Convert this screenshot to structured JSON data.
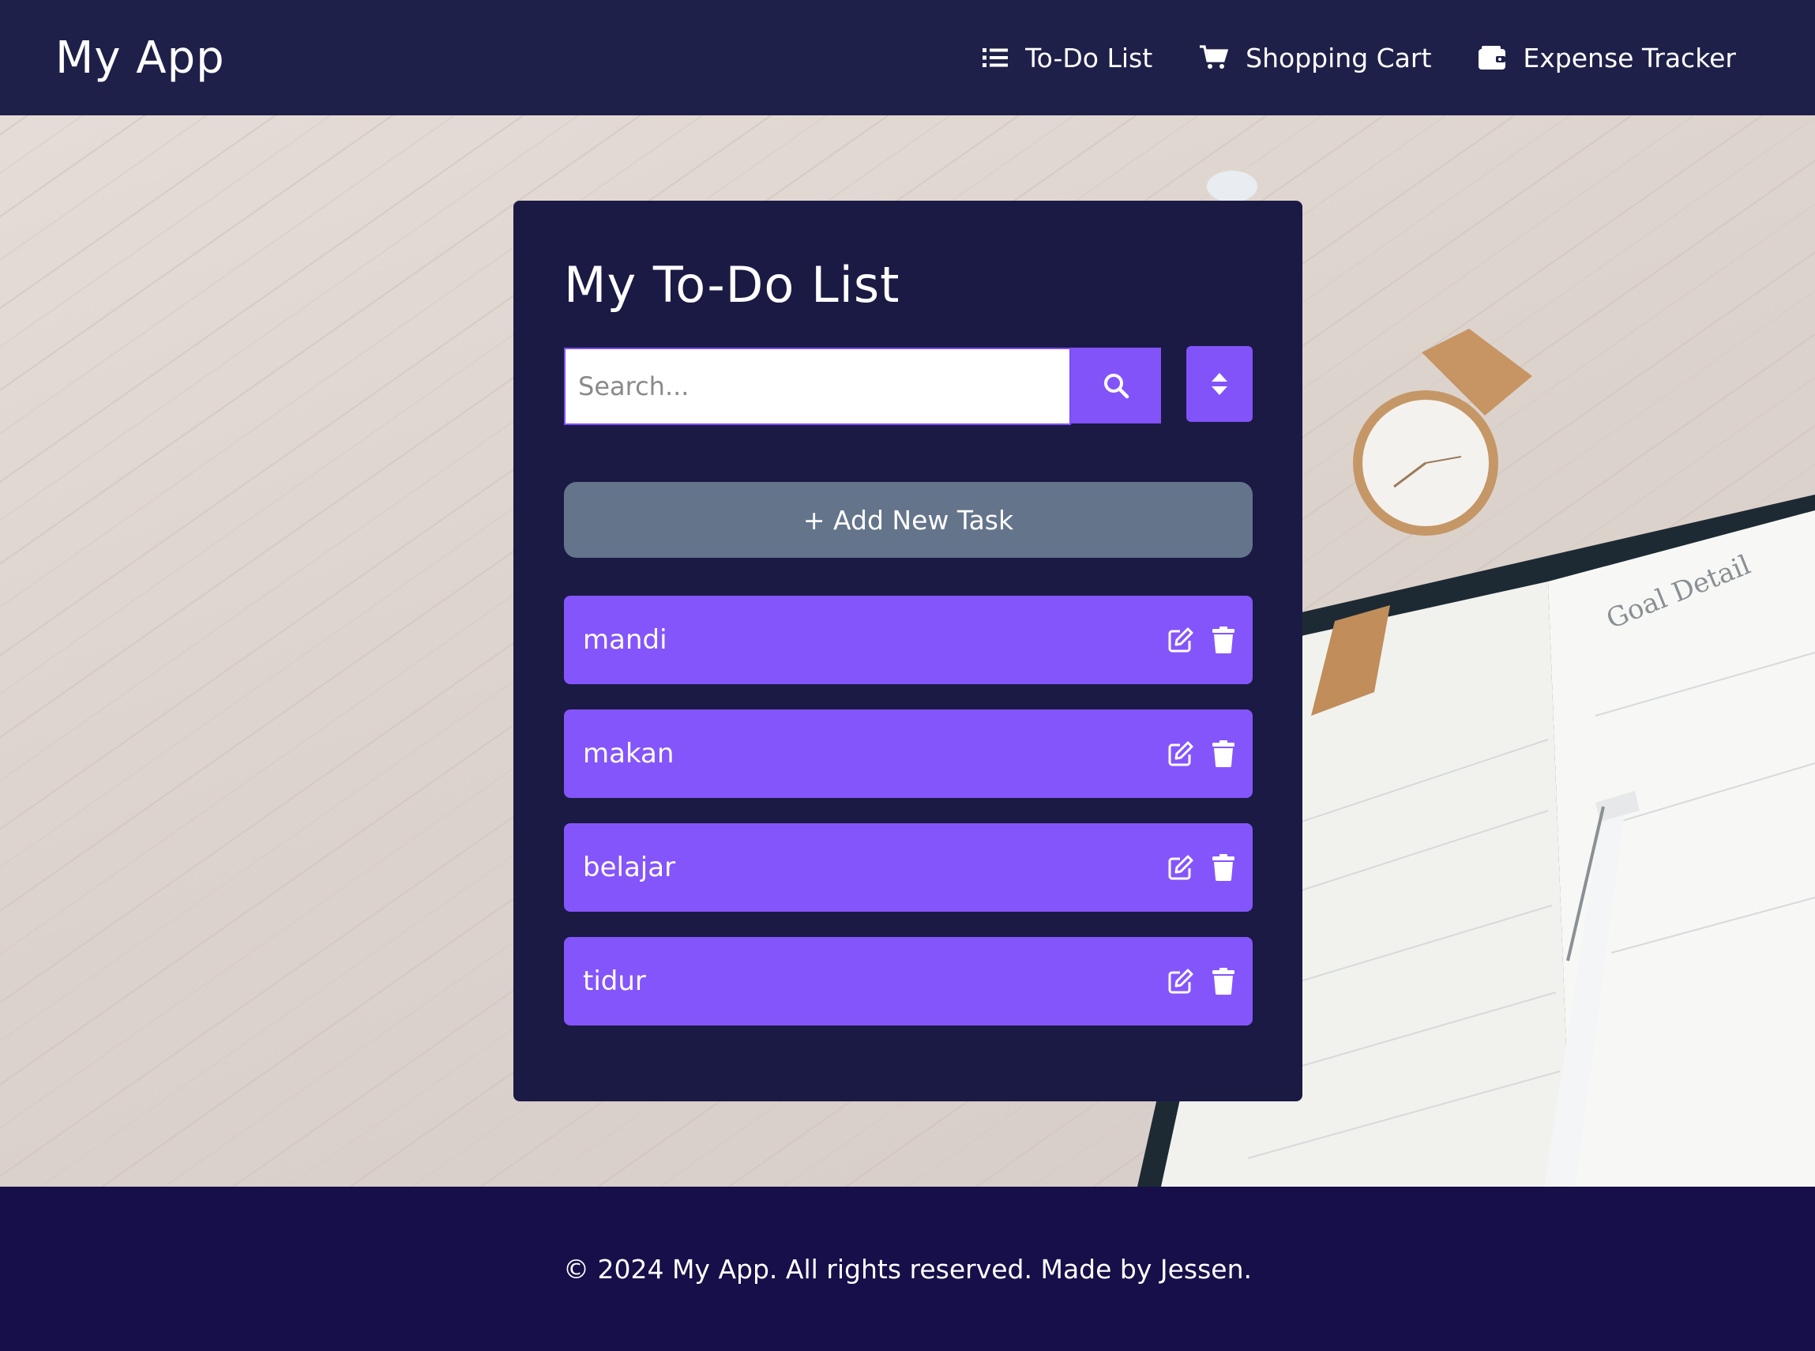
{
  "header": {
    "brand": "My App",
    "nav": [
      {
        "label": "To-Do List",
        "icon": "list-icon"
      },
      {
        "label": "Shopping Cart",
        "icon": "cart-icon"
      },
      {
        "label": "Expense Tracker",
        "icon": "wallet-icon"
      }
    ]
  },
  "todo": {
    "title": "My To-Do List",
    "search_placeholder": "Search...",
    "search_icon": "search-icon",
    "sort_icon": "sort-icon",
    "add_label": "+ Add New Task",
    "tasks": [
      {
        "label": "mandi"
      },
      {
        "label": "makan"
      },
      {
        "label": "belajar"
      },
      {
        "label": "tidur"
      }
    ]
  },
  "footer": {
    "text": "© 2024 My App. All rights reserved. Made by Jessen."
  },
  "colors": {
    "header_bg": "#1f2049",
    "card_bg": "#1b1a44",
    "accent": "#8153f9",
    "add_button": "#64748b",
    "footer_bg": "#170f49"
  }
}
